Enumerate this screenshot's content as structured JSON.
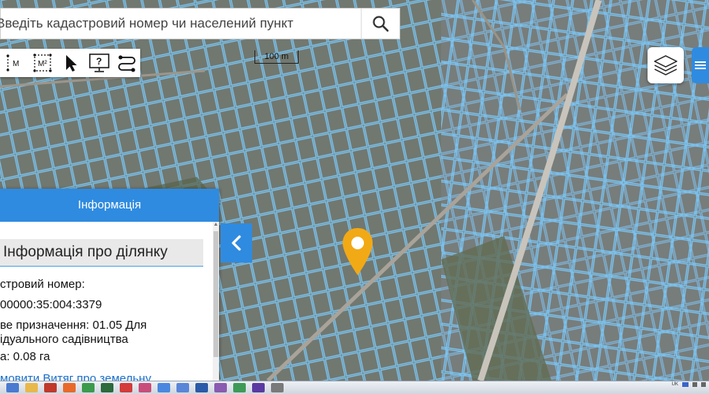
{
  "search": {
    "placeholder": "Введіть кадастровий номер чи населений пункт"
  },
  "toolbar": {
    "tools": [
      {
        "label": "M",
        "icon": "measure-length-icon"
      },
      {
        "label": "M²",
        "icon": "measure-area-icon"
      },
      {
        "label": "",
        "icon": "cursor-arrow-icon"
      },
      {
        "label": "?",
        "icon": "info-monitor-icon"
      },
      {
        "label": "",
        "icon": "route-icon"
      }
    ]
  },
  "map": {
    "scale_label": "100 m",
    "marker_color": "#f2a916"
  },
  "info_panel": {
    "title": "Інформація",
    "section_title": "Інформація про ділянку",
    "lines": [
      "стровий номер:",
      "00000:35:004:3379",
      "ве призначення: 01.05 Для",
      "ідуального садівництва",
      "а: 0.08 га"
    ],
    "link_text": "мовити Витяг про земельну"
  },
  "taskbar": {
    "tray_lang": "UK"
  },
  "colors": {
    "accent": "#2f8be0",
    "parcel_outline": "#7cc4f2",
    "marker": "#f2a916"
  }
}
